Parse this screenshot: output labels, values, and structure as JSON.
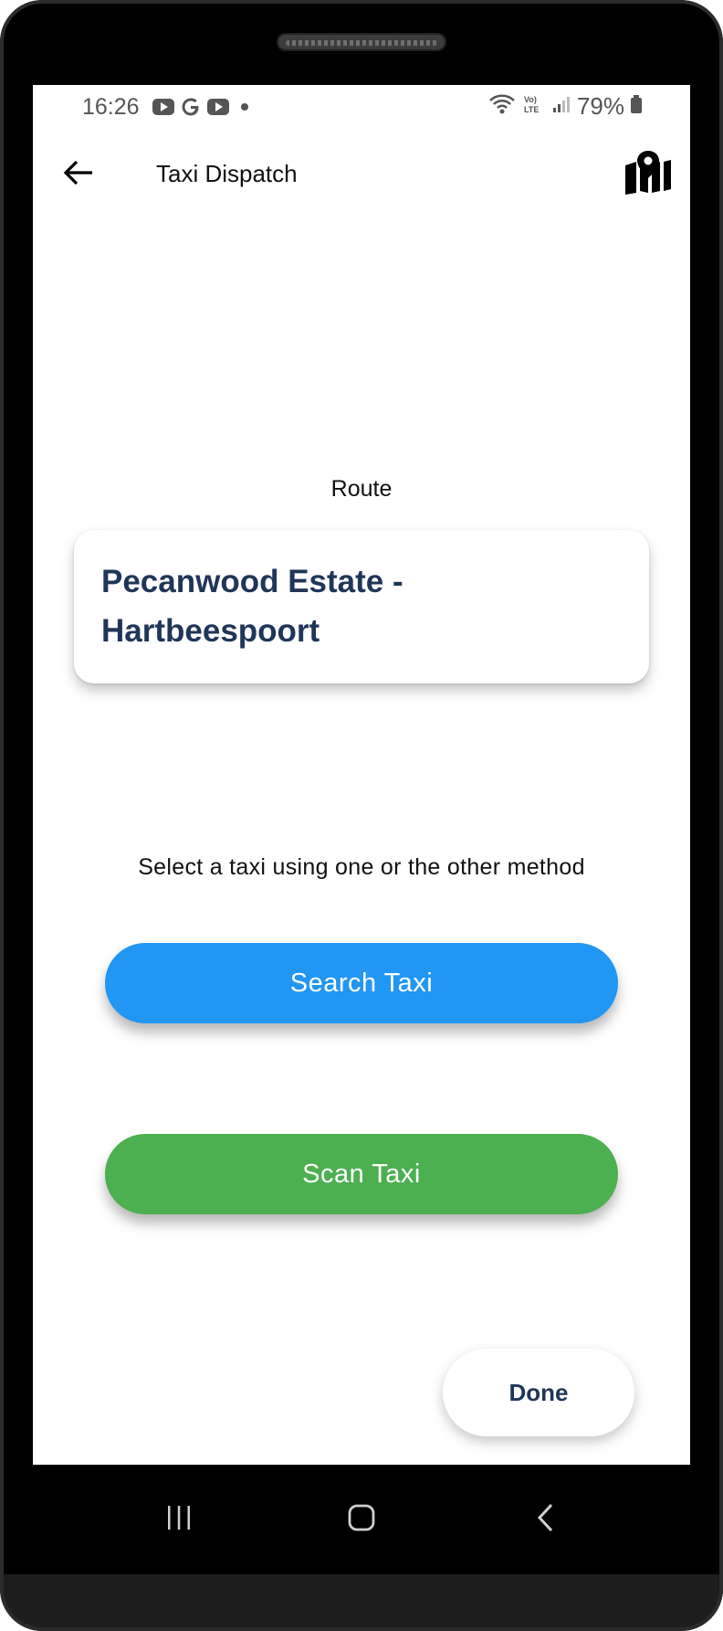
{
  "status_bar": {
    "time": "16:26",
    "notification_icons": [
      "youtube-icon",
      "google-icon",
      "youtube-icon",
      "dot-icon"
    ],
    "battery": "79%",
    "network_label": "Vo) LTE"
  },
  "app_bar": {
    "title": "Taxi Dispatch",
    "back_icon": "arrow-left-icon",
    "map_icon": "map-pin-icon"
  },
  "route": {
    "label": "Route",
    "name": "Pecanwood Estate  - Hartbeespoort"
  },
  "instruction": "Select a taxi using one or the other method",
  "buttons": {
    "search": "Search Taxi",
    "scan": "Scan Taxi",
    "done": "Done"
  },
  "colors": {
    "primary_blue": "#2196f3",
    "scan_green": "#4caf50",
    "route_text": "#1f3658"
  },
  "nav_bar": {
    "items": [
      "recents-icon",
      "home-icon",
      "back-icon"
    ]
  }
}
